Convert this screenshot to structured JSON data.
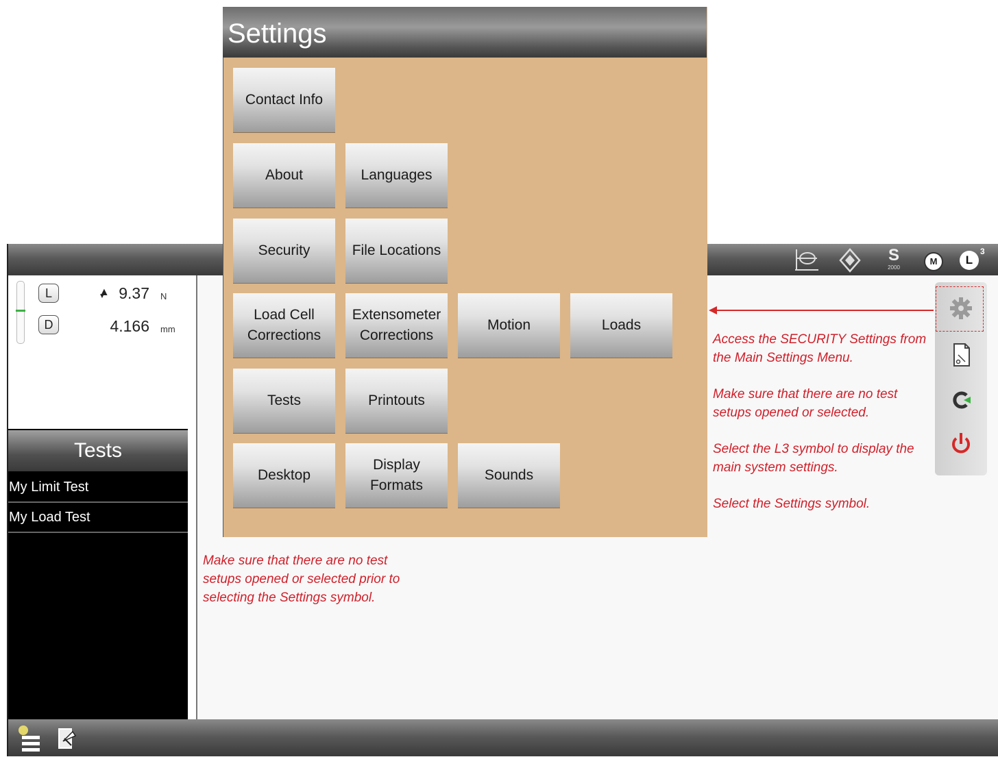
{
  "settings": {
    "title": "Settings",
    "buttons": {
      "contact_info": "Contact Info",
      "about": "About",
      "languages": "Languages",
      "security": "Security",
      "file_locations": "File Locations",
      "load_cell_corrections": "Load Cell Corrections",
      "extensometer_corrections": "Extensometer Corrections",
      "motion": "Motion",
      "loads": "Loads",
      "tests": "Tests",
      "printouts": "Printouts",
      "desktop": "Desktop",
      "display_formats": "Display Formats",
      "sounds": "Sounds"
    }
  },
  "topbar": {
    "icons": [
      "graph-icon",
      "compass-icon",
      "s2000-icon",
      "message-icon",
      "l3-icon"
    ],
    "s_label": "S",
    "s_sub": "2000",
    "l_label": "L",
    "l_superscript": "3",
    "m_label": "M"
  },
  "readouts": {
    "load": {
      "channel": "L",
      "value": "9.37",
      "unit": "N"
    },
    "distance": {
      "channel": "D",
      "value": "4.166",
      "unit": "mm"
    }
  },
  "tests_panel": {
    "header": "Tests",
    "items": [
      "My Limit Test",
      "My Load Test"
    ]
  },
  "side_panel": {
    "icons": [
      "gear-icon",
      "document-icon",
      "refresh-icon",
      "power-icon"
    ]
  },
  "annotations": {
    "right_1": "Access the SECURITY Settings from the Main Settings Menu.",
    "right_2": "Make sure that there are no test setups opened or selected.",
    "right_3": "Select the L3 symbol to display the main system settings.",
    "right_4": "Select the Settings symbol.",
    "bottom": "Make sure that there are no test setups opened or selected prior to selecting the Settings symbol."
  },
  "colors": {
    "annotation": "#d0202a",
    "dialog_bg": "#dcb688",
    "accent_green": "#3cb043",
    "power_red": "#d62828"
  }
}
